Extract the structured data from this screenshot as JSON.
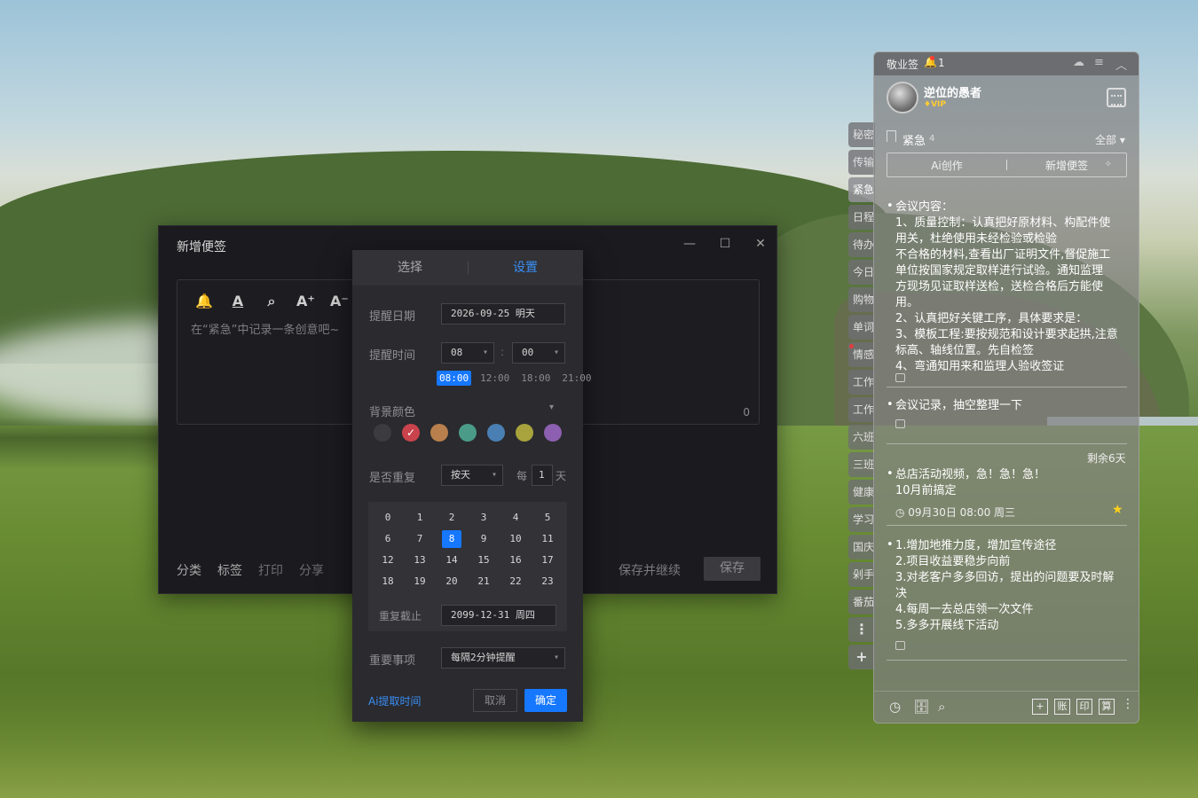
{
  "note_window": {
    "title": "新增便签",
    "controls": {
      "minimize": "—",
      "maximize": "☐",
      "close": "✕"
    },
    "toolbar_icons": [
      "bell-icon",
      "text-color-icon",
      "search-icon",
      "font-increase-icon",
      "font-decrease-icon"
    ],
    "toolbar_glyphs": [
      "🔔",
      "A",
      "⌕",
      "A⁺",
      "A⁻"
    ],
    "placeholder": "在“紧急”中记录一条创意吧~",
    "char_count": "0",
    "bottom_actions": [
      "分类",
      "标签",
      "打印",
      "分享"
    ],
    "save_continue": "保存并继续",
    "save": "保存"
  },
  "reminder": {
    "tabs": [
      "选择",
      "设置"
    ],
    "active_tab": "设置",
    "date_label": "提醒日期",
    "date_value": "2026-09-25 明天",
    "time_label": "提醒时间",
    "hour": "08",
    "colon": ":",
    "minute": "00",
    "quick_times": [
      "08:00",
      "12:00",
      "18:00",
      "21:00"
    ],
    "selected_quick_time": "08:00",
    "bg_label": "背景颜色",
    "bg_toggle": "▾",
    "colors": [
      "#3c3c40",
      "#c9434c",
      "#b9804d",
      "#4a9c88",
      "#4a7fb3",
      "#a8a33c",
      "#8c5fb0"
    ],
    "selected_color_index": 1,
    "check_glyph": "✓",
    "repeat_label": "是否重复",
    "repeat_value": "按天",
    "every_label": "每",
    "interval": "1",
    "interval_unit": "天",
    "hours": [
      "0",
      "1",
      "2",
      "3",
      "4",
      "5",
      "6",
      "7",
      "8",
      "9",
      "10",
      "11",
      "12",
      "13",
      "14",
      "15",
      "16",
      "17",
      "18",
      "19",
      "20",
      "21",
      "22",
      "23"
    ],
    "selected_hour": "8",
    "until_label": "重复截止",
    "until_value": "2099-12-31 周四",
    "important_label": "重要事项",
    "important_value": "每隔2分钟提醒",
    "ai_extract": "Ai提取时间",
    "cancel": "取消",
    "confirm": "确定"
  },
  "side_tabs": {
    "items": [
      "秘密",
      "传输",
      "紧急",
      "日程",
      "待办",
      "今日",
      "购物",
      "单词",
      "情感",
      "工作",
      "工作",
      "六班",
      "三班",
      "健康",
      "学习",
      "国庆",
      "剁手",
      "番茄"
    ],
    "active_index": 2,
    "red_dot_index": 8,
    "more_glyph": "⋮",
    "add_glyph": "+"
  },
  "panel": {
    "app_name": "敬业签",
    "bell_glyph": "🔔",
    "notification_count": "1",
    "header_glyphs": {
      "cloud": "☁",
      "menu": "≡",
      "collapse": "︿"
    },
    "username": "逆位的愚者",
    "vip": "♦VIP",
    "category_name": "紧急",
    "category_count": "4",
    "filter": "全部 ▾",
    "ai_create": "Ai创作",
    "new_note": "新增便签",
    "ai_icon": "✧",
    "bullet": "•",
    "notes": [
      {
        "lines": [
          "会议内容：",
          "1、质量控制：认真把好原材料、构配件使",
          "用关，杜绝使用未经检验或检验",
          "不合格的材料,查看出厂证明文件,督促施工",
          "单位按国家规定取样进行试验。通知监理",
          "方现场见证取样送检，送检合格后方能使",
          "用。",
          "2、认真把好关键工序，具体要求是：",
          "3、模板工程:要按规范和设计要求起拱,注意",
          "标高、轴线位置。先自检签",
          "4、弯通知用来和监理人验收签证"
        ]
      },
      {
        "lines": [
          "会议记录，抽空整理一下"
        ]
      },
      {
        "remain": "剩余6天",
        "lines": [
          "总店活动视频，急！急！急！",
          "10月前搞定"
        ],
        "meta": "◷ 09月30日 08:00 周三",
        "star": "★"
      },
      {
        "lines": [
          "1.增加地推力度，增加宣传途径",
          "2.项目收益要稳步向前",
          "3.对老客户多多回访，提出的问题要及时解",
          "决",
          "4.每周一去总店领一次文件",
          "5.多多开展线下活动"
        ]
      }
    ],
    "footer_glyphs": {
      "history": "◷",
      "archive": "🗄",
      "search": "⌕",
      "add": "+",
      "ledger": "账",
      "print": "印",
      "calc": "算",
      "more": "⋮"
    }
  }
}
